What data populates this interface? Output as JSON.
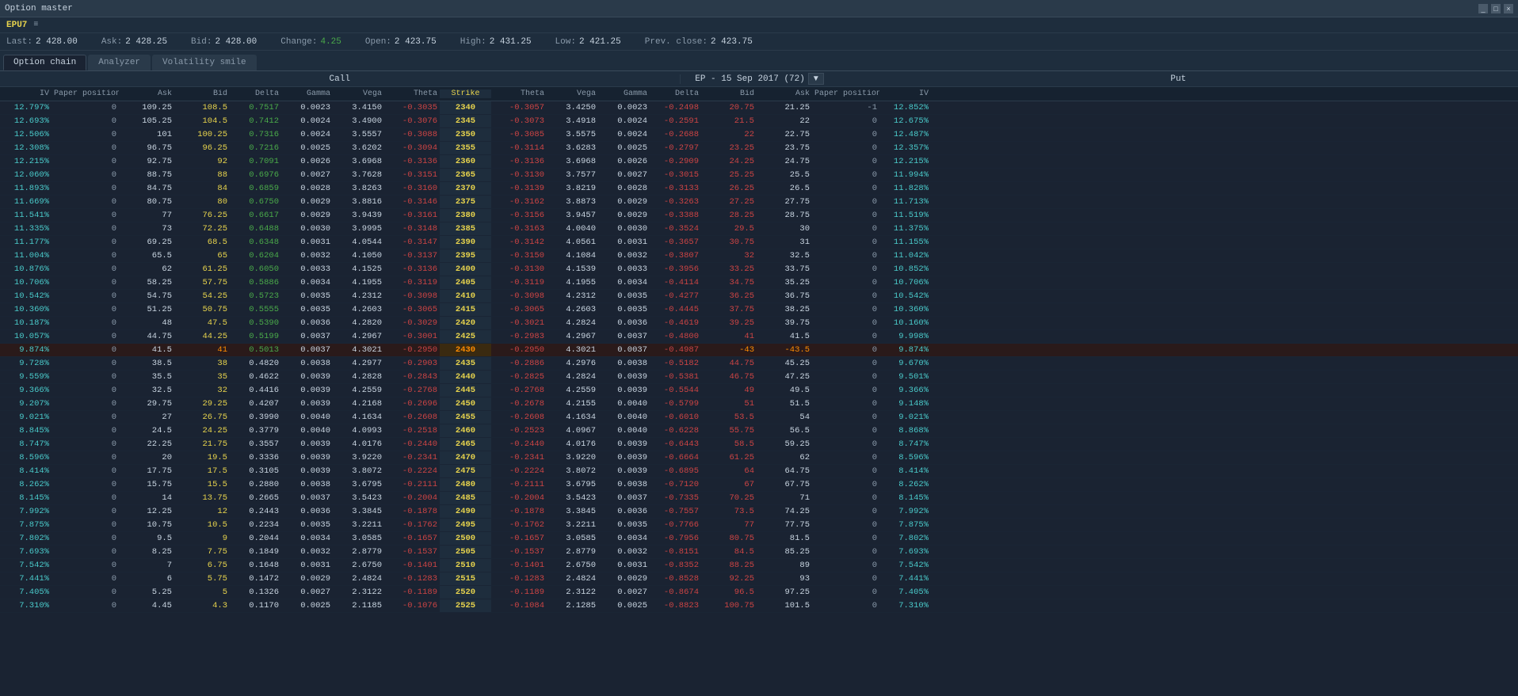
{
  "titleBar": {
    "title": "Option master",
    "controls": [
      "_",
      "□",
      "×"
    ]
  },
  "instrument": {
    "name": "EPU7"
  },
  "prices": {
    "last_label": "Last:",
    "last_value": "2 428.00",
    "ask_label": "Ask:",
    "ask_value": "2 428.25",
    "bid_label": "Bid:",
    "bid_value": "2 428.00",
    "change_label": "Change:",
    "change_value": "4.25",
    "open_label": "Open:",
    "open_value": "2 423.75",
    "high_label": "High:",
    "high_value": "2 431.25",
    "low_label": "Low:",
    "low_value": "2 421.25",
    "prev_label": "Prev. close:",
    "prev_value": "2 423.75"
  },
  "tabs": [
    {
      "label": "Option chain",
      "active": true
    },
    {
      "label": "Analyzer",
      "active": false
    },
    {
      "label": "Volatility smile",
      "active": false
    }
  ],
  "expiry": {
    "label": "EP - 15 Sep 2017 (72)"
  },
  "columns": {
    "call": "Call",
    "put": "Put",
    "iv": "IV",
    "pp": "Paper position",
    "ask": "Ask",
    "bid": "Bid",
    "delta": "Delta",
    "gamma": "Gamma",
    "vega": "Vega",
    "theta": "Theta",
    "strike": "Strike"
  },
  "rows": [
    {
      "iv_c": "12.797%",
      "pp_c": "0",
      "ask_c": "109.25",
      "bid_c": "108.5",
      "delta_c": "0.7517",
      "gamma_c": "0.0023",
      "vega_c": "3.4150",
      "theta_c": "-0.3035",
      "strike": "2340",
      "theta_p": "-0.3057",
      "vega_p": "3.4250",
      "gamma_p": "0.0023",
      "delta_p": "-0.2498",
      "bid_p": "20.75",
      "ask_p": "21.25",
      "pp_p": "-1",
      "iv_p": "12.852%",
      "atm": false
    },
    {
      "iv_c": "12.693%",
      "pp_c": "0",
      "ask_c": "105.25",
      "bid_c": "104.5",
      "delta_c": "0.7412",
      "gamma_c": "0.0024",
      "vega_c": "3.4900",
      "theta_c": "-0.3076",
      "strike": "2345",
      "theta_p": "-0.3073",
      "vega_p": "3.4918",
      "gamma_p": "0.0024",
      "delta_p": "-0.2591",
      "bid_p": "21.5",
      "ask_p": "22",
      "pp_p": "0",
      "iv_p": "12.675%",
      "atm": false
    },
    {
      "iv_c": "12.506%",
      "pp_c": "0",
      "ask_c": "101",
      "bid_c": "100.25",
      "delta_c": "0.7316",
      "gamma_c": "0.0024",
      "vega_c": "3.5557",
      "theta_c": "-0.3088",
      "strike": "2350",
      "theta_p": "-0.3085",
      "vega_p": "3.5575",
      "gamma_p": "0.0024",
      "delta_p": "-0.2688",
      "bid_p": "22",
      "ask_p": "22.75",
      "pp_p": "0",
      "iv_p": "12.487%",
      "atm": false
    },
    {
      "iv_c": "12.308%",
      "pp_c": "0",
      "ask_c": "96.75",
      "bid_c": "96.25",
      "delta_c": "0.7216",
      "gamma_c": "0.0025",
      "vega_c": "3.6202",
      "theta_c": "-0.3094",
      "strike": "2355",
      "theta_p": "-0.3114",
      "vega_p": "3.6283",
      "gamma_p": "0.0025",
      "delta_p": "-0.2797",
      "bid_p": "23.25",
      "ask_p": "23.75",
      "pp_p": "0",
      "iv_p": "12.357%",
      "atm": false
    },
    {
      "iv_c": "12.215%",
      "pp_c": "0",
      "ask_c": "92.75",
      "bid_c": "92",
      "delta_c": "0.7091",
      "gamma_c": "0.0026",
      "vega_c": "3.6968",
      "theta_c": "-0.3136",
      "strike": "2360",
      "theta_p": "-0.3136",
      "vega_p": "3.6968",
      "gamma_p": "0.0026",
      "delta_p": "-0.2909",
      "bid_p": "24.25",
      "ask_p": "24.75",
      "pp_p": "0",
      "iv_p": "12.215%",
      "atm": false
    },
    {
      "iv_c": "12.060%",
      "pp_c": "0",
      "ask_c": "88.75",
      "bid_c": "88",
      "delta_c": "0.6976",
      "gamma_c": "0.0027",
      "vega_c": "3.7628",
      "theta_c": "-0.3151",
      "strike": "2365",
      "theta_p": "-0.3130",
      "vega_p": "3.7577",
      "gamma_p": "0.0027",
      "delta_p": "-0.3015",
      "bid_p": "25.25",
      "ask_p": "25.5",
      "pp_p": "0",
      "iv_p": "11.994%",
      "atm": false
    },
    {
      "iv_c": "11.893%",
      "pp_c": "0",
      "ask_c": "84.75",
      "bid_c": "84",
      "delta_c": "0.6859",
      "gamma_c": "0.0028",
      "vega_c": "3.8263",
      "theta_c": "-0.3160",
      "strike": "2370",
      "theta_p": "-0.3139",
      "vega_p": "3.8219",
      "gamma_p": "0.0028",
      "delta_p": "-0.3133",
      "bid_p": "26.25",
      "ask_p": "26.5",
      "pp_p": "0",
      "iv_p": "11.828%",
      "atm": false
    },
    {
      "iv_c": "11.669%",
      "pp_c": "0",
      "ask_c": "80.75",
      "bid_c": "80",
      "delta_c": "0.6750",
      "gamma_c": "0.0029",
      "vega_c": "3.8816",
      "theta_c": "-0.3146",
      "strike": "2375",
      "theta_p": "-0.3162",
      "vega_p": "3.8873",
      "gamma_p": "0.0029",
      "delta_p": "-0.3263",
      "bid_p": "27.25",
      "ask_p": "27.75",
      "pp_p": "0",
      "iv_p": "11.713%",
      "atm": false
    },
    {
      "iv_c": "11.541%",
      "pp_c": "0",
      "ask_c": "77",
      "bid_c": "76.25",
      "delta_c": "0.6617",
      "gamma_c": "0.0029",
      "vega_c": "3.9439",
      "theta_c": "-0.3161",
      "strike": "2380",
      "theta_p": "-0.3156",
      "vega_p": "3.9457",
      "gamma_p": "0.0029",
      "delta_p": "-0.3388",
      "bid_p": "28.25",
      "ask_p": "28.75",
      "pp_p": "0",
      "iv_p": "11.519%",
      "atm": false
    },
    {
      "iv_c": "11.335%",
      "pp_c": "0",
      "ask_c": "73",
      "bid_c": "72.25",
      "delta_c": "0.6488",
      "gamma_c": "0.0030",
      "vega_c": "3.9995",
      "theta_c": "-0.3148",
      "strike": "2385",
      "theta_p": "-0.3163",
      "vega_p": "4.0040",
      "gamma_p": "0.0030",
      "delta_p": "-0.3524",
      "bid_p": "29.5",
      "ask_p": "30",
      "pp_p": "0",
      "iv_p": "11.375%",
      "atm": false
    },
    {
      "iv_c": "11.177%",
      "pp_c": "0",
      "ask_c": "69.25",
      "bid_c": "68.5",
      "delta_c": "0.6348",
      "gamma_c": "0.0031",
      "vega_c": "4.0544",
      "theta_c": "-0.3147",
      "strike": "2390",
      "theta_p": "-0.3142",
      "vega_p": "4.0561",
      "gamma_p": "0.0031",
      "delta_p": "-0.3657",
      "bid_p": "30.75",
      "ask_p": "31",
      "pp_p": "0",
      "iv_p": "11.155%",
      "atm": false
    },
    {
      "iv_c": "11.004%",
      "pp_c": "0",
      "ask_c": "65.5",
      "bid_c": "65",
      "delta_c": "0.6204",
      "gamma_c": "0.0032",
      "vega_c": "4.1050",
      "theta_c": "-0.3137",
      "strike": "2395",
      "theta_p": "-0.3150",
      "vega_p": "4.1084",
      "gamma_p": "0.0032",
      "delta_p": "-0.3807",
      "bid_p": "32",
      "ask_p": "32.5",
      "pp_p": "0",
      "iv_p": "11.042%",
      "atm": false
    },
    {
      "iv_c": "10.876%",
      "pp_c": "0",
      "ask_c": "62",
      "bid_c": "61.25",
      "delta_c": "0.6050",
      "gamma_c": "0.0033",
      "vega_c": "4.1525",
      "theta_c": "-0.3136",
      "strike": "2400",
      "theta_p": "-0.3130",
      "vega_p": "4.1539",
      "gamma_p": "0.0033",
      "delta_p": "-0.3956",
      "bid_p": "33.25",
      "ask_p": "33.75",
      "pp_p": "0",
      "iv_p": "10.852%",
      "atm": false
    },
    {
      "iv_c": "10.706%",
      "pp_c": "0",
      "ask_c": "58.25",
      "bid_c": "57.75",
      "delta_c": "0.5886",
      "gamma_c": "0.0034",
      "vega_c": "4.1955",
      "theta_c": "-0.3119",
      "strike": "2405",
      "theta_p": "-0.3119",
      "vega_p": "4.1955",
      "gamma_p": "0.0034",
      "delta_p": "-0.4114",
      "bid_p": "34.75",
      "ask_p": "35.25",
      "pp_p": "0",
      "iv_p": "10.706%",
      "atm": false
    },
    {
      "iv_c": "10.542%",
      "pp_c": "0",
      "ask_c": "54.75",
      "bid_c": "54.25",
      "delta_c": "0.5723",
      "gamma_c": "0.0035",
      "vega_c": "4.2312",
      "theta_c": "-0.3098",
      "strike": "2410",
      "theta_p": "-0.3098",
      "vega_p": "4.2312",
      "gamma_p": "0.0035",
      "delta_p": "-0.4277",
      "bid_p": "36.25",
      "ask_p": "36.75",
      "pp_p": "0",
      "iv_p": "10.542%",
      "atm": false
    },
    {
      "iv_c": "10.360%",
      "pp_c": "0",
      "ask_c": "51.25",
      "bid_c": "50.75",
      "delta_c": "0.5555",
      "gamma_c": "0.0035",
      "vega_c": "4.2603",
      "theta_c": "-0.3065",
      "strike": "2415",
      "theta_p": "-0.3065",
      "vega_p": "4.2603",
      "gamma_p": "0.0035",
      "delta_p": "-0.4445",
      "bid_p": "37.75",
      "ask_p": "38.25",
      "pp_p": "0",
      "iv_p": "10.360%",
      "atm": false
    },
    {
      "iv_c": "10.187%",
      "pp_c": "0",
      "ask_c": "48",
      "bid_c": "47.5",
      "delta_c": "0.5390",
      "gamma_c": "0.0036",
      "vega_c": "4.2820",
      "theta_c": "-0.3029",
      "strike": "2420",
      "theta_p": "-0.3021",
      "vega_p": "4.2824",
      "gamma_p": "0.0036",
      "delta_p": "-0.4619",
      "bid_p": "39.25",
      "ask_p": "39.75",
      "pp_p": "0",
      "iv_p": "10.160%",
      "atm": false
    },
    {
      "iv_c": "10.057%",
      "pp_c": "0",
      "ask_c": "44.75",
      "bid_c": "44.25",
      "delta_c": "0.5199",
      "gamma_c": "0.0037",
      "vega_c": "4.2967",
      "theta_c": "-0.3001",
      "strike": "2425",
      "theta_p": "-0.2983",
      "vega_p": "4.2967",
      "gamma_p": "0.0037",
      "delta_p": "-0.4800",
      "bid_p": "41",
      "ask_p": "41.5",
      "pp_p": "0",
      "iv_p": "9.998%",
      "atm": false
    },
    {
      "iv_c": "9.874%",
      "pp_c": "0",
      "ask_c": "41.5",
      "bid_c": "41",
      "delta_c": "0.5013",
      "gamma_c": "0.0037",
      "vega_c": "4.3021",
      "theta_c": "-0.2950",
      "strike": "2430",
      "theta_p": "-0.2950",
      "vega_p": "4.3021",
      "gamma_p": "0.0037",
      "delta_p": "-0.4987",
      "bid_p": "-43",
      "ask_p": "-43.5",
      "pp_p": "0",
      "iv_p": "9.874%",
      "atm": true
    },
    {
      "iv_c": "9.728%",
      "pp_c": "0",
      "ask_c": "38.5",
      "bid_c": "38",
      "delta_c": "0.4820",
      "gamma_c": "0.0038",
      "vega_c": "4.2977",
      "theta_c": "-0.2903",
      "strike": "2435",
      "theta_p": "-0.2886",
      "vega_p": "4.2976",
      "gamma_p": "0.0038",
      "delta_p": "-0.5182",
      "bid_p": "44.75",
      "ask_p": "45.25",
      "pp_p": "0",
      "iv_p": "9.670%",
      "atm": false
    },
    {
      "iv_c": "9.559%",
      "pp_c": "0",
      "ask_c": "35.5",
      "bid_c": "35",
      "delta_c": "0.4622",
      "gamma_c": "0.0039",
      "vega_c": "4.2828",
      "theta_c": "-0.2843",
      "strike": "2440",
      "theta_p": "-0.2825",
      "vega_p": "4.2824",
      "gamma_p": "0.0039",
      "delta_p": "-0.5381",
      "bid_p": "46.75",
      "ask_p": "47.25",
      "pp_p": "0",
      "iv_p": "9.501%",
      "atm": false
    },
    {
      "iv_c": "9.366%",
      "pp_c": "0",
      "ask_c": "32.5",
      "bid_c": "32",
      "delta_c": "0.4416",
      "gamma_c": "0.0039",
      "vega_c": "4.2559",
      "theta_c": "-0.2768",
      "strike": "2445",
      "theta_p": "-0.2768",
      "vega_p": "4.2559",
      "gamma_p": "0.0039",
      "delta_p": "-0.5544",
      "bid_p": "49",
      "ask_p": "49.5",
      "pp_p": "0",
      "iv_p": "9.366%",
      "atm": false
    },
    {
      "iv_c": "9.207%",
      "pp_c": "0",
      "ask_c": "29.75",
      "bid_c": "29.25",
      "delta_c": "0.4207",
      "gamma_c": "0.0039",
      "vega_c": "4.2168",
      "theta_c": "-0.2696",
      "strike": "2450",
      "theta_p": "-0.2678",
      "vega_p": "4.2155",
      "gamma_p": "0.0040",
      "delta_p": "-0.5799",
      "bid_p": "51",
      "ask_p": "51.5",
      "pp_p": "0",
      "iv_p": "9.148%",
      "atm": false
    },
    {
      "iv_c": "9.021%",
      "pp_c": "0",
      "ask_c": "27",
      "bid_c": "26.75",
      "delta_c": "0.3990",
      "gamma_c": "0.0040",
      "vega_c": "4.1634",
      "theta_c": "-0.2608",
      "strike": "2455",
      "theta_p": "-0.2608",
      "vega_p": "4.1634",
      "gamma_p": "0.0040",
      "delta_p": "-0.6010",
      "bid_p": "53.5",
      "ask_p": "54",
      "pp_p": "0",
      "iv_p": "9.021%",
      "atm": false
    },
    {
      "iv_c": "8.845%",
      "pp_c": "0",
      "ask_c": "24.5",
      "bid_c": "24.25",
      "delta_c": "0.3779",
      "gamma_c": "0.0040",
      "vega_c": "4.0993",
      "theta_c": "-0.2518",
      "strike": "2460",
      "theta_p": "-0.2523",
      "vega_p": "4.0967",
      "gamma_p": "0.0040",
      "delta_p": "-0.6228",
      "bid_p": "55.75",
      "ask_p": "56.5",
      "pp_p": "0",
      "iv_p": "8.868%",
      "atm": false
    },
    {
      "iv_c": "8.747%",
      "pp_c": "0",
      "ask_c": "22.25",
      "bid_c": "21.75",
      "delta_c": "0.3557",
      "gamma_c": "0.0039",
      "vega_c": "4.0176",
      "theta_c": "-0.2440",
      "strike": "2465",
      "theta_p": "-0.2440",
      "vega_p": "4.0176",
      "gamma_p": "0.0039",
      "delta_p": "-0.6443",
      "bid_p": "58.5",
      "ask_p": "59.25",
      "pp_p": "0",
      "iv_p": "8.747%",
      "atm": false
    },
    {
      "iv_c": "8.596%",
      "pp_c": "0",
      "ask_c": "20",
      "bid_c": "19.5",
      "delta_c": "0.3336",
      "gamma_c": "0.0039",
      "vega_c": "3.9220",
      "theta_c": "-0.2341",
      "strike": "2470",
      "theta_p": "-0.2341",
      "vega_p": "3.9220",
      "gamma_p": "0.0039",
      "delta_p": "-0.6664",
      "bid_p": "61.25",
      "ask_p": "62",
      "pp_p": "0",
      "iv_p": "8.596%",
      "atm": false
    },
    {
      "iv_c": "8.414%",
      "pp_c": "0",
      "ask_c": "17.75",
      "bid_c": "17.5",
      "delta_c": "0.3105",
      "gamma_c": "0.0039",
      "vega_c": "3.8072",
      "theta_c": "-0.2224",
      "strike": "2475",
      "theta_p": "-0.2224",
      "vega_p": "3.8072",
      "gamma_p": "0.0039",
      "delta_p": "-0.6895",
      "bid_p": "64",
      "ask_p": "64.75",
      "pp_p": "0",
      "iv_p": "8.414%",
      "atm": false
    },
    {
      "iv_c": "8.262%",
      "pp_c": "0",
      "ask_c": "15.75",
      "bid_c": "15.5",
      "delta_c": "0.2880",
      "gamma_c": "0.0038",
      "vega_c": "3.6795",
      "theta_c": "-0.2111",
      "strike": "2480",
      "theta_p": "-0.2111",
      "vega_p": "3.6795",
      "gamma_p": "0.0038",
      "delta_p": "-0.7120",
      "bid_p": "67",
      "ask_p": "67.75",
      "pp_p": "0",
      "iv_p": "8.262%",
      "atm": false
    },
    {
      "iv_c": "8.145%",
      "pp_c": "0",
      "ask_c": "14",
      "bid_c": "13.75",
      "delta_c": "0.2665",
      "gamma_c": "0.0037",
      "vega_c": "3.5423",
      "theta_c": "-0.2004",
      "strike": "2485",
      "theta_p": "-0.2004",
      "vega_p": "3.5423",
      "gamma_p": "0.0037",
      "delta_p": "-0.7335",
      "bid_p": "70.25",
      "ask_p": "71",
      "pp_p": "0",
      "iv_p": "8.145%",
      "atm": false
    },
    {
      "iv_c": "7.992%",
      "pp_c": "0",
      "ask_c": "12.25",
      "bid_c": "12",
      "delta_c": "0.2443",
      "gamma_c": "0.0036",
      "vega_c": "3.3845",
      "theta_c": "-0.1878",
      "strike": "2490",
      "theta_p": "-0.1878",
      "vega_p": "3.3845",
      "gamma_p": "0.0036",
      "delta_p": "-0.7557",
      "bid_p": "73.5",
      "ask_p": "74.25",
      "pp_p": "0",
      "iv_p": "7.992%",
      "atm": false
    },
    {
      "iv_c": "7.875%",
      "pp_c": "0",
      "ask_c": "10.75",
      "bid_c": "10.5",
      "delta_c": "0.2234",
      "gamma_c": "0.0035",
      "vega_c": "3.2211",
      "theta_c": "-0.1762",
      "strike": "2495",
      "theta_p": "-0.1762",
      "vega_p": "3.2211",
      "gamma_p": "0.0035",
      "delta_p": "-0.7766",
      "bid_p": "77",
      "ask_p": "77.75",
      "pp_p": "0",
      "iv_p": "7.875%",
      "atm": false
    },
    {
      "iv_c": "7.802%",
      "pp_c": "0",
      "ask_c": "9.5",
      "bid_c": "9",
      "delta_c": "0.2044",
      "gamma_c": "0.0034",
      "vega_c": "3.0585",
      "theta_c": "-0.1657",
      "strike": "2500",
      "theta_p": "-0.1657",
      "vega_p": "3.0585",
      "gamma_p": "0.0034",
      "delta_p": "-0.7956",
      "bid_p": "80.75",
      "ask_p": "81.5",
      "pp_p": "0",
      "iv_p": "7.802%",
      "atm": false
    },
    {
      "iv_c": "7.693%",
      "pp_c": "0",
      "ask_c": "8.25",
      "bid_c": "7.75",
      "delta_c": "0.1849",
      "gamma_c": "0.0032",
      "vega_c": "2.8779",
      "theta_c": "-0.1537",
      "strike": "2505",
      "theta_p": "-0.1537",
      "vega_p": "2.8779",
      "gamma_p": "0.0032",
      "delta_p": "-0.8151",
      "bid_p": "84.5",
      "ask_p": "85.25",
      "pp_p": "0",
      "iv_p": "7.693%",
      "atm": false
    },
    {
      "iv_c": "7.542%",
      "pp_c": "0",
      "ask_c": "7",
      "bid_c": "6.75",
      "delta_c": "0.1648",
      "gamma_c": "0.0031",
      "vega_c": "2.6750",
      "theta_c": "-0.1401",
      "strike": "2510",
      "theta_p": "-0.1401",
      "vega_p": "2.6750",
      "gamma_p": "0.0031",
      "delta_p": "-0.8352",
      "bid_p": "88.25",
      "ask_p": "89",
      "pp_p": "0",
      "iv_p": "7.542%",
      "atm": false
    },
    {
      "iv_c": "7.441%",
      "pp_c": "0",
      "ask_c": "6",
      "bid_c": "5.75",
      "delta_c": "0.1472",
      "gamma_c": "0.0029",
      "vega_c": "2.4824",
      "theta_c": "-0.1283",
      "strike": "2515",
      "theta_p": "-0.1283",
      "vega_p": "2.4824",
      "gamma_p": "0.0029",
      "delta_p": "-0.8528",
      "bid_p": "92.25",
      "ask_p": "93",
      "pp_p": "0",
      "iv_p": "7.441%",
      "atm": false
    },
    {
      "iv_c": "7.405%",
      "pp_c": "0",
      "ask_c": "5.25",
      "bid_c": "5",
      "delta_c": "0.1326",
      "gamma_c": "0.0027",
      "vega_c": "2.3122",
      "theta_c": "-0.1189",
      "strike": "2520",
      "theta_p": "-0.1189",
      "vega_p": "2.3122",
      "gamma_p": "0.0027",
      "delta_p": "-0.8674",
      "bid_p": "96.5",
      "ask_p": "97.25",
      "pp_p": "0",
      "iv_p": "7.405%",
      "atm": false
    },
    {
      "iv_c": "7.310%",
      "pp_c": "0",
      "ask_c": "4.45",
      "bid_c": "4.3",
      "delta_c": "0.1170",
      "gamma_c": "0.0025",
      "vega_c": "2.1185",
      "theta_c": "-0.1076",
      "strike": "2525",
      "theta_p": "-0.1084",
      "vega_p": "2.1285",
      "gamma_p": "0.0025",
      "delta_p": "-0.8823",
      "bid_p": "100.75",
      "ask_p": "101.5",
      "pp_p": "0",
      "iv_p": "7.310%",
      "atm": false
    }
  ]
}
